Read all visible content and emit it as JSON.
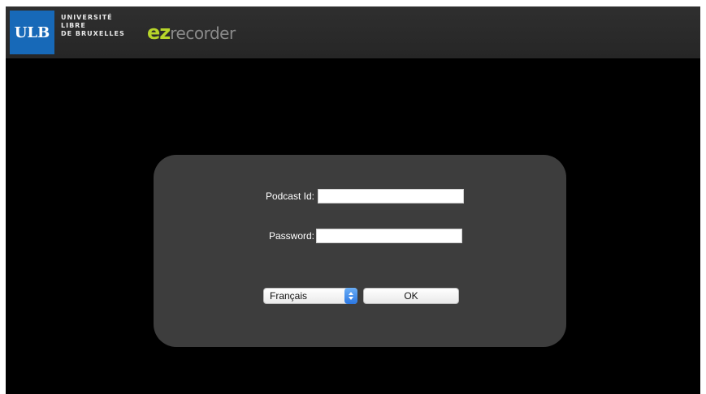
{
  "header": {
    "ulb_badge": "ULB",
    "university_lines": [
      "UNIVERSITÉ",
      "LIBRE",
      "DE BRUXELLES"
    ],
    "app_logo_prefix": "ez",
    "app_logo_suffix": "recorder",
    "colors": {
      "ulb_blue": "#1769b8",
      "ez_green": "#b7d52a"
    }
  },
  "login": {
    "podcast_id_label": "Podcast Id:",
    "podcast_id_value": "",
    "password_label": "Password:",
    "password_value": "",
    "language_selected": "Français",
    "ok_label": "OK"
  }
}
